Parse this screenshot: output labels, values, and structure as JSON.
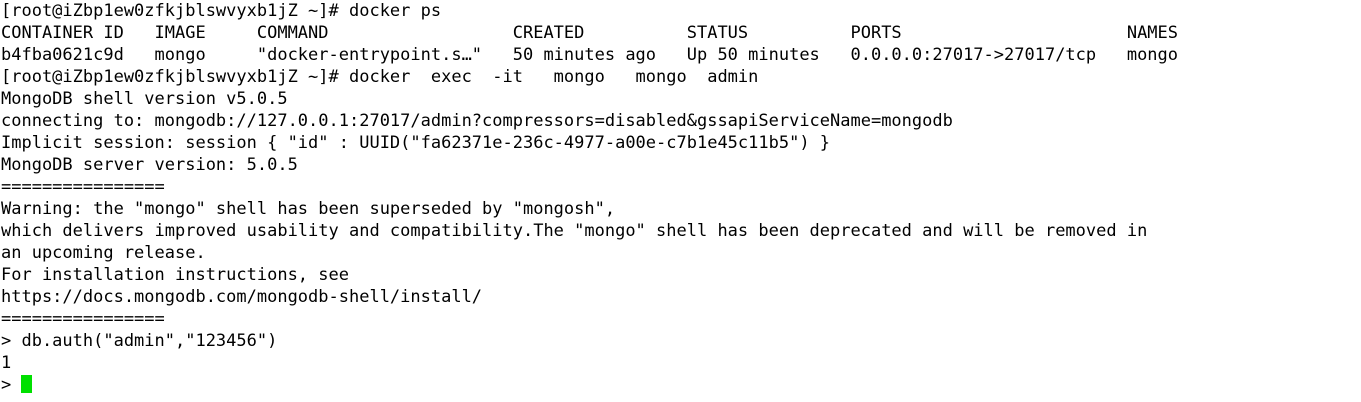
{
  "terminal": {
    "lines": [
      "[root@iZbp1ew0zfkjblswvyxb1jZ ~]# docker ps",
      "CONTAINER ID   IMAGE     COMMAND                  CREATED          STATUS          PORTS                      NAMES",
      "b4fba0621c9d   mongo     \"docker-entrypoint.s…\"   50 minutes ago   Up 50 minutes   0.0.0.0:27017->27017/tcp   mongo",
      "[root@iZbp1ew0zfkjblswvyxb1jZ ~]# docker  exec  -it   mongo   mongo  admin",
      "MongoDB shell version v5.0.5",
      "connecting to: mongodb://127.0.0.1:27017/admin?compressors=disabled&gssapiServiceName=mongodb",
      "Implicit session: session { \"id\" : UUID(\"fa62371e-236c-4977-a00e-c7b1e45c11b5\") }",
      "MongoDB server version: 5.0.5",
      "================",
      "Warning: the \"mongo\" shell has been superseded by \"mongosh\",",
      "which delivers improved usability and compatibility.The \"mongo\" shell has been deprecated and will be removed in",
      "an upcoming release.",
      "For installation instructions, see",
      "https://docs.mongodb.com/mongodb-shell/install/",
      "================",
      "> db.auth(\"admin\",\"123456\")",
      "1"
    ],
    "prompt": "> ",
    "cursor_color": "#00e000"
  }
}
